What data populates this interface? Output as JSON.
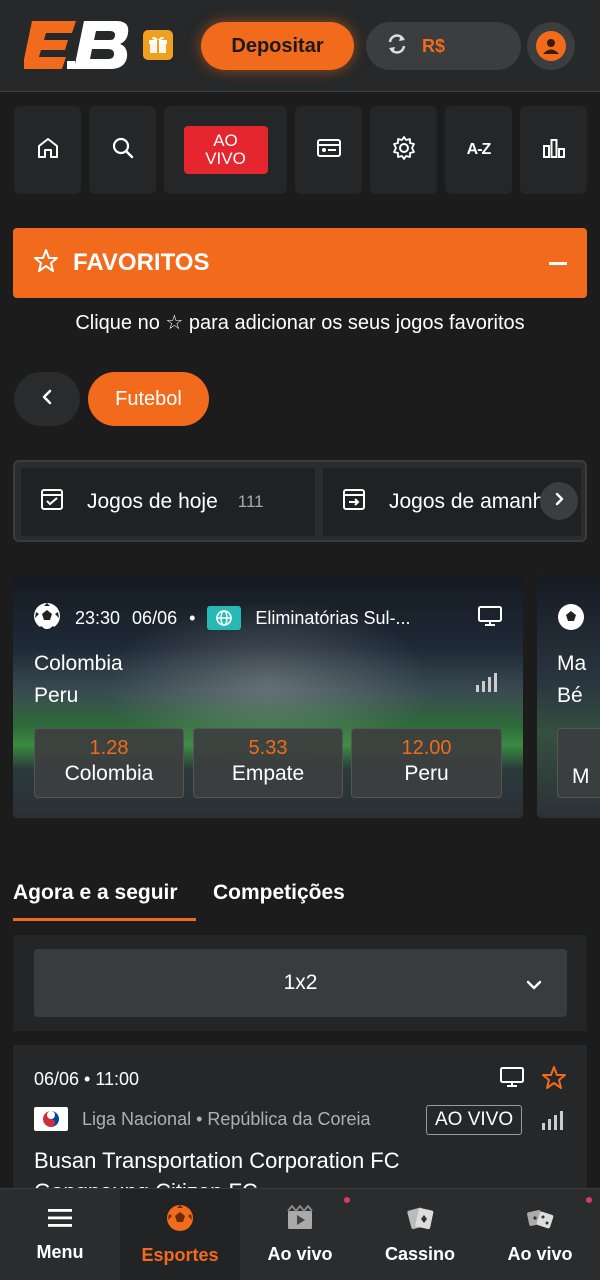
{
  "header": {
    "logo": "E.B",
    "deposit_label": "Depositar",
    "currency": "R$"
  },
  "nav": {
    "live_line1": "AO",
    "live_line2": "VIVO",
    "az_label": "A-Z"
  },
  "favorites": {
    "title": "FAVORITOS",
    "hint": "Clique no ☆ para adicionar os seus jogos favoritos"
  },
  "sport_filter": {
    "selected": "Futebol"
  },
  "games_tabs": [
    {
      "label": "Jogos de hoje",
      "count": "111"
    },
    {
      "label": "Jogos de amanhã",
      "count": ""
    }
  ],
  "featured_match": {
    "time": "23:30",
    "date": "06/06",
    "separator": "•",
    "competition": "Eliminatórias Sul-...",
    "home": "Colombia",
    "away": "Peru",
    "odds": [
      {
        "value": "1.28",
        "label": "Colombia"
      },
      {
        "value": "5.33",
        "label": "Empate"
      },
      {
        "value": "12.00",
        "label": "Peru"
      }
    ]
  },
  "next_match_peek": {
    "home": "Ma",
    "away": "Bé",
    "odd_label": "M"
  },
  "section_tabs": [
    {
      "label": "Agora e a seguir",
      "active": true
    },
    {
      "label": "Competições",
      "active": false
    }
  ],
  "market": {
    "selected": "1x2"
  },
  "event": {
    "datetime": "06/06 • 11:00",
    "league": "Liga Nacional • República da Coreia",
    "live_label": "AO VIVO",
    "home": "Busan Transportation Corporation FC",
    "away": "Gangneung Citizen FC"
  },
  "bottom_nav": [
    {
      "label": "Menu",
      "icon": "menu-icon",
      "active": false
    },
    {
      "label": "Esportes",
      "icon": "soccer-ball-icon",
      "active": true
    },
    {
      "label": "Ao vivo",
      "icon": "live-video-icon",
      "active": false
    },
    {
      "label": "Cassino",
      "icon": "casino-icon",
      "active": false
    },
    {
      "label": "Ao vivo",
      "icon": "live-casino-icon",
      "active": false
    }
  ],
  "colors": {
    "accent": "#f26a1b",
    "live_red": "#e5262e",
    "background": "#1c1c1c"
  }
}
